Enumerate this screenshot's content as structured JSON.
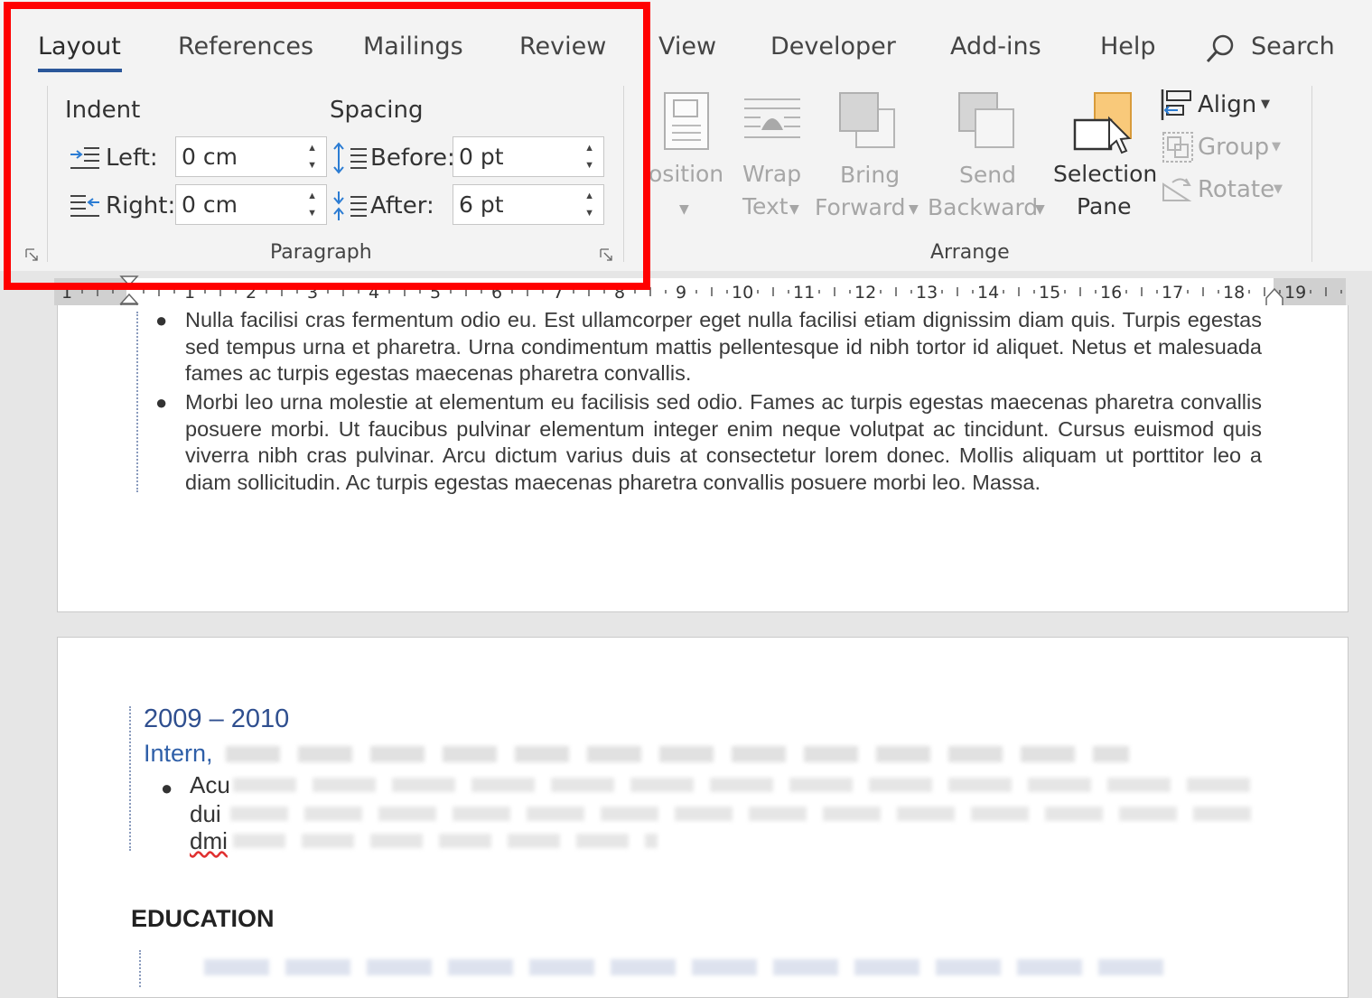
{
  "ribbon": {
    "tabs": [
      {
        "label": "Layout",
        "active": true
      },
      {
        "label": "References"
      },
      {
        "label": "Mailings"
      },
      {
        "label": "Review"
      },
      {
        "label": "View"
      },
      {
        "label": "Developer"
      },
      {
        "label": "Add-ins"
      },
      {
        "label": "Help"
      }
    ],
    "search_label": "Search",
    "paragraph": {
      "group_label": "Paragraph",
      "indent_heading": "Indent",
      "spacing_heading": "Spacing",
      "left_label": "Left:",
      "left_value": "0 cm",
      "right_label": "Right:",
      "right_value": "0 cm",
      "before_label": "Before:",
      "before_value": "0 pt",
      "after_label": "After:",
      "after_value": "6 pt"
    },
    "arrange": {
      "group_label": "Arrange",
      "position_label": "osition",
      "wrap_line1": "Wrap",
      "wrap_line2": "Text",
      "bring_line1": "Bring",
      "bring_line2": "Forward",
      "send_line1": "Send",
      "send_line2": "Backward",
      "selection_line1": "Selection",
      "selection_line2": "Pane",
      "align_label": "Align",
      "group_btn_label": "Group",
      "rotate_label": "Rotate"
    }
  },
  "ruler": {
    "numbers": [
      "1",
      "1",
      "2",
      "3",
      "4",
      "5",
      "6",
      "7",
      "8",
      "9",
      "10",
      "11",
      "12",
      "13",
      "14",
      "15",
      "16",
      "17",
      "18",
      "19"
    ]
  },
  "document": {
    "page1": {
      "bullets": [
        "Nulla facilisi cras fermentum odio eu. Est ullamcorper eget nulla facilisi etiam dignissim diam quis. Turpis egestas sed tempus urna et pharetra. Urna condimentum mattis pellentesque id nibh tortor id aliquet. Netus et malesuada fames ac turpis egestas maecenas pharetra convallis.",
        "Morbi leo urna molestie at elementum eu facilisis sed odio. Fames ac turpis egestas maecenas pharetra convallis posuere morbi. Ut faucibus pulvinar elementum integer enim neque volutpat ac tincidunt. Cursus euismod quis viverra nibh cras pulvinar. Arcu dictum varius duis at consectetur lorem donec. Mollis aliquam ut porttitor leo a diam sollicitudin. Ac turpis egestas maecenas pharetra convallis posuere morbi leo. Massa."
      ]
    },
    "page2": {
      "date_range": "2009 – 2010",
      "job_title": "Intern,",
      "job_bullet_prefix": "Acu",
      "job_bullet_line2_prefix": "dui",
      "job_bullet_line3_prefix": "dmi",
      "section_heading": "EDUCATION"
    }
  },
  "colors": {
    "accent_blue": "#2b579a",
    "heading_blue": "#2f4f8f",
    "highlight_red": "#ff0000",
    "pane_orange": "#f9c97a"
  }
}
